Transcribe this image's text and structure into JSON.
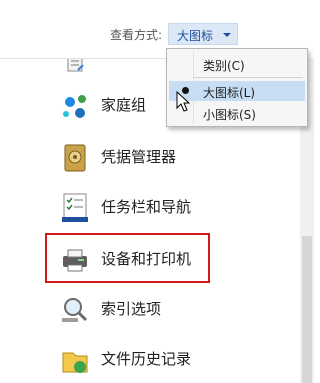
{
  "toolbar": {
    "view_by_label": "查看方式:",
    "view_by_value": "大图标"
  },
  "view_menu": {
    "items": [
      {
        "label": "类别(C)",
        "selected": false
      },
      {
        "label": "大图标(L)",
        "selected": true
      },
      {
        "label": "小图标(S)",
        "selected": false
      }
    ]
  },
  "control_panel": {
    "items": [
      {
        "label": "",
        "icon": "control-panel-icon"
      },
      {
        "label": "家庭组",
        "icon": "homegroup-icon"
      },
      {
        "label": "凭据管理器",
        "icon": "credential-manager-icon"
      },
      {
        "label": "任务栏和导航",
        "icon": "taskbar-navigation-icon"
      },
      {
        "label": "设备和打印机",
        "icon": "devices-printers-icon",
        "highlighted": true
      },
      {
        "label": "索引选项",
        "icon": "indexing-options-icon"
      },
      {
        "label": "文件历史记录",
        "icon": "file-history-icon"
      }
    ]
  },
  "colors": {
    "highlight_border": "#d21818",
    "selected_menu_bg": "#c6ddf4",
    "view_select_text": "#1f4fa0"
  }
}
